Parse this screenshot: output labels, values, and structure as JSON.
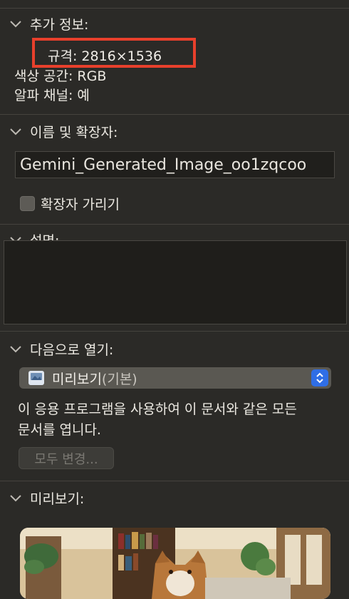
{
  "more_info": {
    "header": "추가 정보:",
    "dimensions": "규격: 2816×1536",
    "color_space": "색상 공간: RGB",
    "alpha_channel": "알파 채널: 예"
  },
  "name_ext": {
    "header": "이름 및 확장자:",
    "filename": "Gemini_Generated_Image_oo1zqcoo",
    "hide_extension": "확장자 가리기"
  },
  "comments": {
    "header": "설명:"
  },
  "open_with": {
    "header": "다음으로 열기:",
    "app": "미리보기",
    "app_suffix": "(기본)",
    "note_line1": "이 응용 프로그램을 사용하여 이 문서와 같은 모든",
    "note_line2": "문서를 엽니다.",
    "change_all": "모두 변경..."
  },
  "preview": {
    "header": "미리보기:"
  },
  "colors": {
    "background": "#2b2a27",
    "highlight": "#e8402c",
    "stepper": "#2f6ee6"
  }
}
